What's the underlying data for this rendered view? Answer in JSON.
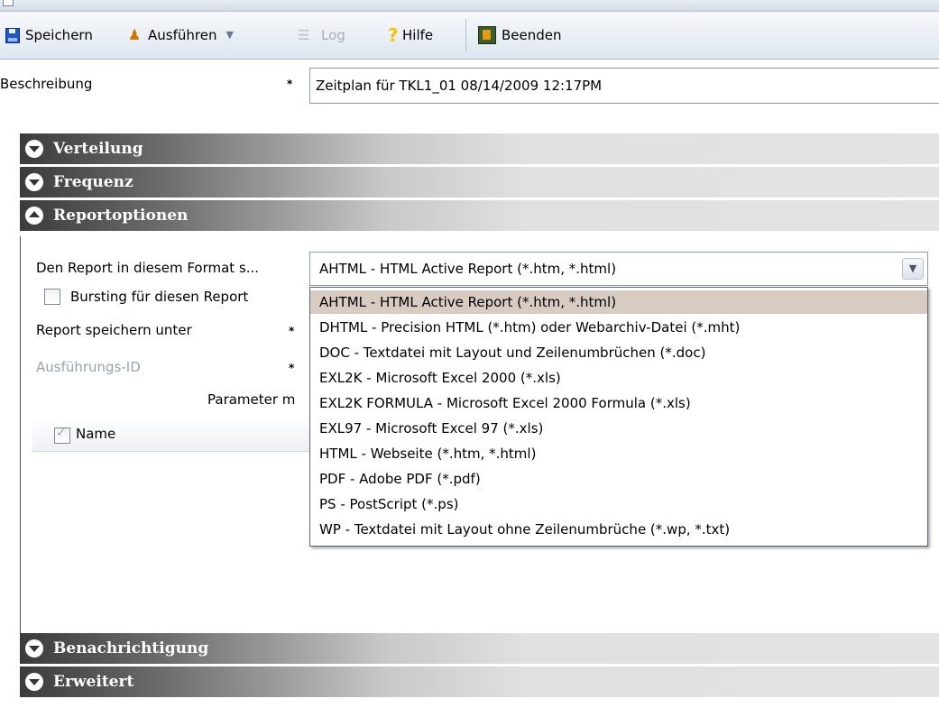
{
  "toolbar": {
    "save": "Speichern",
    "run": "Ausführen",
    "log": "Log",
    "help": "Hilfe",
    "exit": "Beenden"
  },
  "description": {
    "label": "Beschreibung",
    "required_marker": "*",
    "value": "Zeitplan für TKL1_01 08/14/2009 12:17PM"
  },
  "sections": {
    "verteilung": "Verteilung",
    "frequenz": "Frequenz",
    "reportoptionen": "Reportoptionen",
    "benachrichtigung": "Benachrichtigung",
    "erweitert": "Erweitert"
  },
  "report_options": {
    "format_label": "Den Report in diesem Format s...",
    "format_selected": "AHTML - HTML Active Report (*.htm, *.html)",
    "bursting_label": "Bursting für diesen Report",
    "save_as_label": "Report speichern unter",
    "execution_id_label": "Ausführungs-ID",
    "parameter_label": "Parameter m",
    "grid_column_name": "Name",
    "required_marker": "*"
  },
  "format_options": [
    "AHTML - HTML Active Report (*.htm, *.html)",
    "DHTML - Precision HTML (*.htm) oder Webarchiv-Datei (*.mht)",
    "DOC - Textdatei mit Layout und Zeilenumbrüchen (*.doc)",
    "EXL2K - Microsoft Excel 2000 (*.xls)",
    "EXL2K FORMULA - Microsoft Excel 2000 Formula (*.xls)",
    "EXL97 - Microsoft Excel 97 (*.xls)",
    "HTML - Webseite (*.htm, *.html)",
    "PDF - Adobe PDF (*.pdf)",
    "PS - PostScript (*.ps)",
    "WP - Textdatei mit Layout ohne Zeilenumbrüche (*.wp, *.txt)"
  ],
  "colors": {
    "section_dark": "#3b3b3b",
    "selected_option_bg": "#d8cbc1",
    "toolbar_bg": "#dfe6f0"
  }
}
